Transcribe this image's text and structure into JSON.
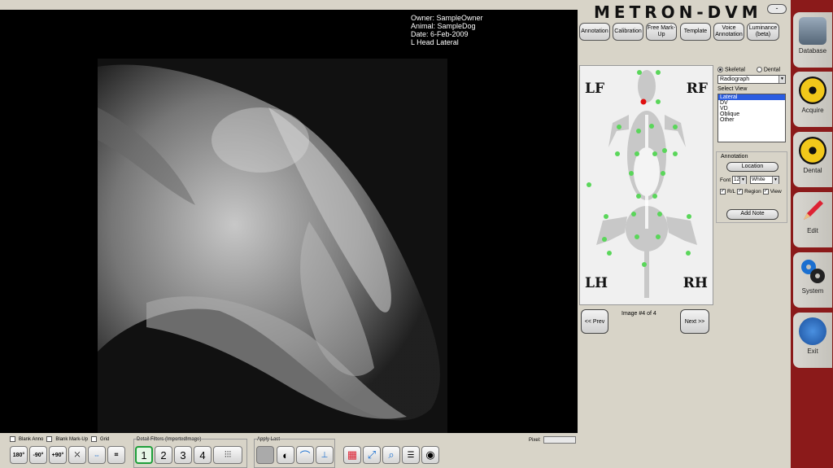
{
  "xray_info": {
    "owner": "Owner: SampleOwner",
    "animal": "Animal: SampleDog",
    "date": "Date: 6-Feb-2009",
    "view": "L Head Lateral"
  },
  "brand": {
    "title": "METRON-DVM",
    "minimize": "-"
  },
  "toolbar": {
    "annotation": "Annotation",
    "calibration": "Calibration",
    "free_markup": "Free Mark-Up",
    "template": "Template",
    "voice_annotation": "Voice Annotation",
    "luminance": "Luminance (beta)"
  },
  "diagram": {
    "lf": "LF",
    "rf": "RF",
    "lh": "LH",
    "rh": "RH"
  },
  "options": {
    "skeletal": "Skeletal",
    "dental": "Dental",
    "modality": "Radiograph",
    "select_view_label": "Select View",
    "views": [
      "Lateral",
      "DV",
      "VD",
      "Oblique",
      "Other"
    ],
    "selected_view": "Lateral"
  },
  "annotation_panel": {
    "title": "Annotation",
    "location": "Location",
    "font_label": "Font",
    "font_size": "12",
    "color": "White",
    "rl": "R/L",
    "region": "Region",
    "view": "View",
    "add_note": "Add Note"
  },
  "navigation": {
    "prev": "<< Prev",
    "next": "Next >>",
    "counter": "Image #4 of 4"
  },
  "sidebar": {
    "items": [
      {
        "label": "Database",
        "icon": "database-icon"
      },
      {
        "label": "Acquire",
        "icon": "radiation-icon"
      },
      {
        "label": "Dental",
        "icon": "dental-radiation-icon"
      },
      {
        "label": "Edit",
        "icon": "pencil-icon"
      },
      {
        "label": "System",
        "icon": "gears-icon"
      },
      {
        "label": "Exit",
        "icon": "exit-icon"
      }
    ]
  },
  "bottom": {
    "blank_anno": "Blank Anno",
    "blank_markup": "Blank Mark-Up",
    "grid": "Grid",
    "detail_filters": "Detail Filters (ImportedImage)",
    "apply_last": "Apply Last",
    "pixel": "Pixel:",
    "rotate_180": "180°",
    "rotate_m90": "-90°",
    "rotate_p90": "+90°",
    "filters": [
      "1",
      "2",
      "3",
      "4"
    ],
    "accent": "#2a5ce0",
    "filter_active": "#1e9e3a"
  }
}
